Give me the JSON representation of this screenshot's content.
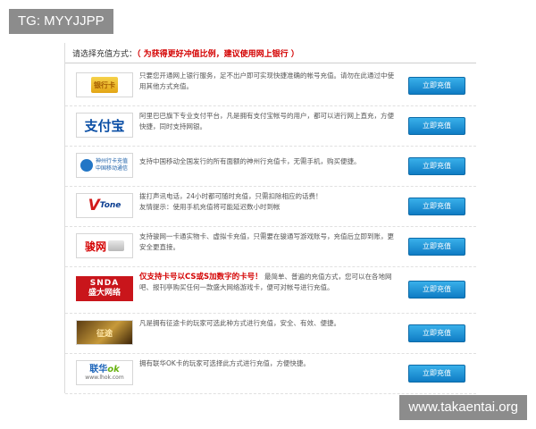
{
  "watermarks": {
    "top": "TG: MYYJJPP",
    "bottom": "www.takaentai.org"
  },
  "header": {
    "label": "请选择充值方式：",
    "hint": "（ 为获得更好冲值比例，建议使用网上银行 ）"
  },
  "button_label": "立即充值",
  "methods": [
    {
      "logo_icon": "bank-card-icon",
      "logo_text": "银行卡",
      "desc": "只要您开通网上银行服务，足不出户即可实现快捷准确的帐号充值。请勿在此通过中使用其他方式充值。"
    },
    {
      "logo_icon": "alipay-icon",
      "logo_text": "支付宝",
      "desc": "阿里巴巴旗下专业支付平台，凡是拥有支付宝帐号的用户，都可以进行网上直充，方便快捷，同时支持网银。"
    },
    {
      "logo_icon": "china-mobile-icon",
      "logo_text": "神州行卡充值",
      "logo_sub": "中国移动通信",
      "desc": "支持中国移动全国发行的所有面额的神州行充值卡，无需手机，购买便捷。"
    },
    {
      "logo_icon": "vtone-icon",
      "logo_text": "V",
      "logo_sub": "Tone",
      "desc": "拨打声讯电话，24小时都可随时充值，只需扣除相应的话费！",
      "desc2": "友情提示：使用手机充值将可能延迟数小时到帐"
    },
    {
      "logo_icon": "junnet-card-icon",
      "logo_text": "骏网",
      "desc": "支持骏网一卡通实物卡、虚拟卡充值，只需要在骏通写游戏账号，充值后立即到账，更安全更直接。"
    },
    {
      "logo_icon": "snda-icon",
      "logo_text": "SNDA",
      "logo_sub": "盛大网络",
      "desc_strong": "仅支持卡号以CS或S加数字的卡号！",
      "desc": "最简单、普遍的充值方式，您可以在各地网吧、报刊亭购买任何一款盛大网络游戏卡，便可对帐号进行充值。"
    },
    {
      "logo_icon": "zhengtu-card-icon",
      "logo_text": "征途",
      "desc": "凡是拥有征途卡的玩家可选此种方式进行充值，安全、有效、便捷。"
    },
    {
      "logo_icon": "ofcard-icon",
      "logo_text": "联华",
      "logo_text2": "ok",
      "logo_sub": "www.lhok.com",
      "desc": "拥有联华OK卡的玩家可选择此方式进行充值，方便快捷。"
    }
  ]
}
